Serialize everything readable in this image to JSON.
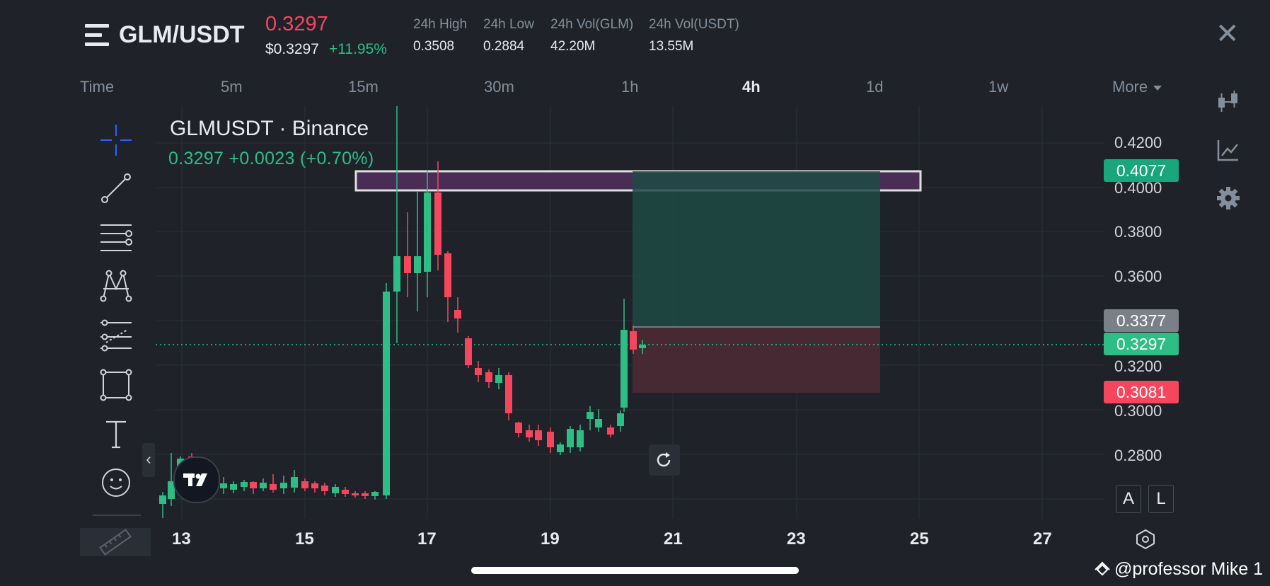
{
  "header": {
    "pair": "GLM/USDT",
    "last_price": "0.3297",
    "price_usd": "$0.3297",
    "change_pct": "+11.95%",
    "stats": [
      {
        "label": "24h High",
        "value": "0.3508"
      },
      {
        "label": "24h Low",
        "value": "0.2884"
      },
      {
        "label": "24h Vol(GLM)",
        "value": "42.20M"
      },
      {
        "label": "24h Vol(USDT)",
        "value": "13.55M"
      }
    ],
    "close_glyph": "✕"
  },
  "timeframes": {
    "time_label": "Time",
    "items": [
      "5m",
      "15m",
      "30m",
      "1h",
      "4h",
      "1d",
      "1w"
    ],
    "active": "4h",
    "more_label": "More"
  },
  "chart": {
    "symbol_title": "GLMUSDT · Binance",
    "quote_line": "0.3297  +0.0023 (+0.70%)",
    "price_axis": [
      "0.4200",
      "0.4000",
      "0.3800",
      "0.3600",
      "0.3200",
      "0.3000",
      "0.2800"
    ],
    "date_axis": [
      "13",
      "15",
      "17",
      "19",
      "21",
      "23",
      "25",
      "27"
    ],
    "tags": {
      "target": "0.4077",
      "entry": "0.3377",
      "current": "0.3297",
      "stop": "0.3081"
    },
    "colors": {
      "up": "#2ebd85",
      "down": "#f6465d",
      "accent": "#2962ff"
    },
    "scale_buttons": [
      "A",
      "L"
    ],
    "collapse_glyph": "‹",
    "logo_text": "TV"
  },
  "watermark": "@professor Mike 1"
}
